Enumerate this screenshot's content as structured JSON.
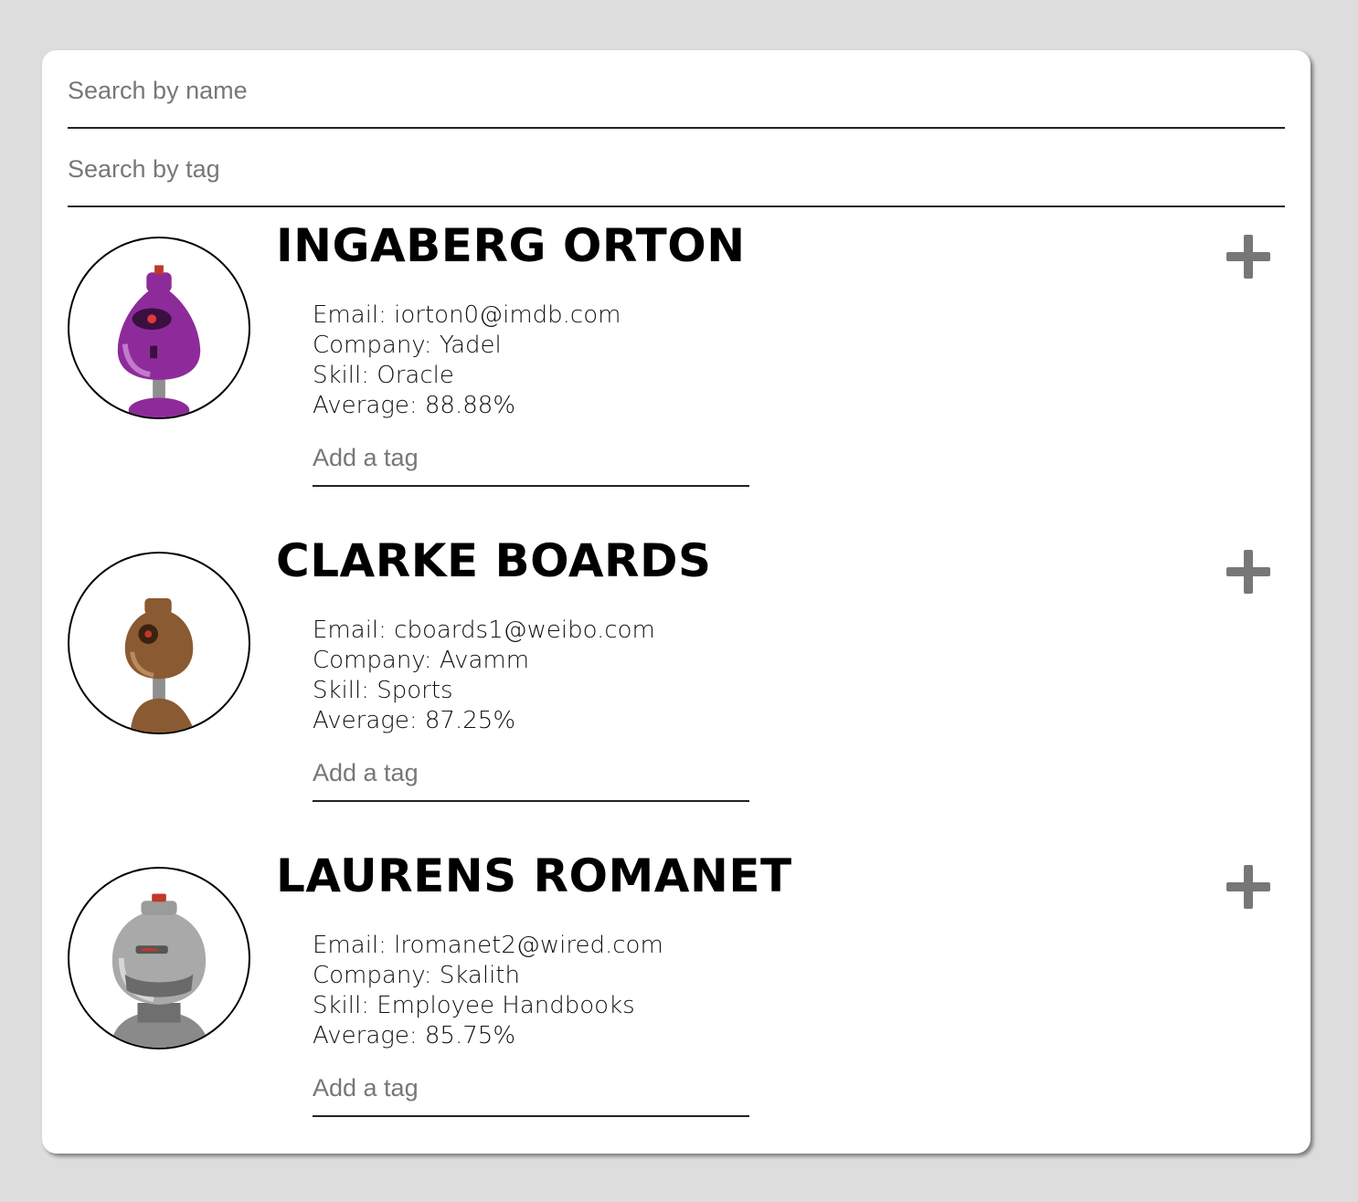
{
  "search": {
    "name_placeholder": "Search by name",
    "tag_placeholder": "Search by tag"
  },
  "students": [
    {
      "name": "INGABERG ORTON",
      "email": "Email: iorton0@imdb.com",
      "company": "Company: Yadel",
      "skill": "Skill: Oracle",
      "average": "Average: 88.88%",
      "tag_placeholder": "Add a tag",
      "avatar_icon": "robot-avatar-purple",
      "avatar_color": "#8e2b9a"
    },
    {
      "name": "CLARKE BOARDS",
      "email": "Email: cboards1@weibo.com",
      "company": "Company: Avamm",
      "skill": "Skill: Sports",
      "average": "Average: 87.25%",
      "tag_placeholder": "Add a tag",
      "avatar_icon": "robot-avatar-brown",
      "avatar_color": "#8a5a32"
    },
    {
      "name": "LAURENS ROMANET",
      "email": "Email: lromanet2@wired.com",
      "company": "Company: Skalith",
      "skill": "Skill: Employee Handbooks",
      "average": "Average: 85.75%",
      "tag_placeholder": "Add a tag",
      "avatar_icon": "robot-avatar-grey",
      "avatar_color": "#9a9a9a"
    }
  ],
  "colors": {
    "background": "#dddddd",
    "card": "#ffffff",
    "plus_icon": "#777777",
    "text": "#111111"
  },
  "icons": {
    "expand": "plus-icon"
  }
}
